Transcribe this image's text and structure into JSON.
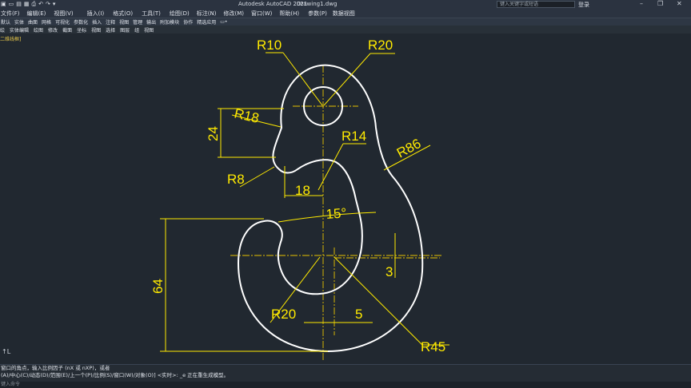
{
  "window": {
    "app_title": "Autodesk AutoCAD 2021",
    "doc_name": "Drawing1.dwg",
    "search_placeholder": "键入关键字或短语",
    "login": "登录",
    "min": "–",
    "restore": "❐",
    "close": "✕"
  },
  "quick_access": [
    "▣",
    "▭",
    "▤",
    "▦",
    "⎙",
    "↶",
    "↷",
    "▾"
  ],
  "menu": [
    "文件(F)",
    "编辑(E)",
    "视图(V)",
    "插入(I)",
    "格式(O)",
    "工具(T)",
    "绘图(D)",
    "标注(N)",
    "修改(M)",
    "窗口(W)",
    "帮助(H)",
    "参数(P)",
    "数据视图"
  ],
  "ribbon": [
    "默认",
    "实体",
    "曲面",
    "网格",
    "可视化",
    "参数化",
    "插入",
    "注释",
    "视图",
    "管理",
    "输出",
    "附加模块",
    "协作",
    "精选应用",
    "▭•"
  ],
  "tabs": [
    "绘",
    "实体编辑",
    "绘图",
    "修改",
    "截面",
    "坐标",
    "视图",
    "选择",
    "图层",
    "组",
    "视图"
  ],
  "view_label": "二维线框]",
  "dimensions": {
    "r10": "R10",
    "r20_top": "R20",
    "r18": "R18",
    "d24": "24",
    "r14": "R14",
    "r86": "R86",
    "r8": "R8",
    "d18": "18",
    "a15": "15°",
    "d64": "64",
    "d3": "3",
    "r20_bottom": "R20",
    "d5": "5",
    "r45": "R45"
  },
  "colors": {
    "background": "#212830",
    "dimension": "#ffea00",
    "centerline": "#e6c200",
    "geometry": "#ffffff"
  },
  "command": {
    "line1": "窗口的角点，输入比例因子 (nX 或 nXP)，或者",
    "line2": "(A)/中心(C)/动态(D)/范围(E)/上一个(P)/比例(S)/窗口(W)/对象(O)] <实时>: _e 正在重生成模型。",
    "input_placeholder": "键入命令"
  },
  "ucs_icon": "↑L"
}
